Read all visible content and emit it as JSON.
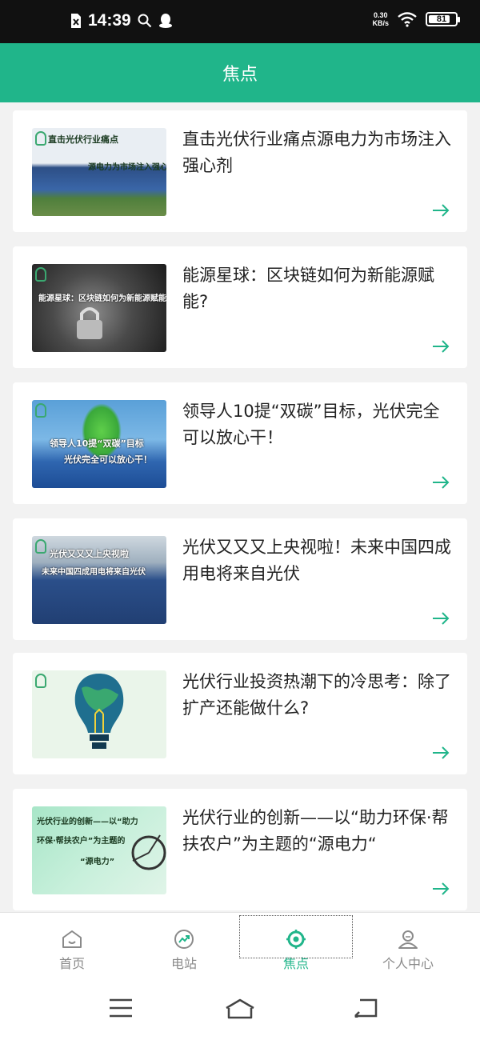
{
  "status_bar": {
    "time": "14:39",
    "net_speed_value": "0.30",
    "net_speed_unit": "KB/s",
    "battery": "81",
    "battery_level": 0.81
  },
  "header": {
    "title": "焦点"
  },
  "articles": [
    {
      "title": "直击光伏行业痛点源电力为市场注入强心剂",
      "thumb_caption_1": "直击光伏行业痛点",
      "thumb_caption_2": "源电力为市场注入强心剂"
    },
    {
      "title": "能源星球：区块链如何为新能源赋能?",
      "thumb_caption_1": "能源星球：区块链如何为新能源赋能?"
    },
    {
      "title": "领导人10提“双碳”目标，光伏完全可以放心干！",
      "thumb_caption_1": "领导人10提“双碳”目标",
      "thumb_caption_2": "光伏完全可以放心干！"
    },
    {
      "title": "光伏又又又上央视啦！未来中国四成用电将来自光伏",
      "thumb_caption_1": "光伏又又又上央视啦",
      "thumb_caption_2": "未来中国四成用电将来自光伏"
    },
    {
      "title": "光伏行业投资热潮下的冷思考：除了扩产还能做什么?"
    },
    {
      "title": "光伏行业的创新——以“助力环保·帮扶农户”为主题的“源电力“",
      "thumb_caption_1": "光伏行业的创新——以“助力",
      "thumb_caption_2": "环保·帮扶农户”为主题的",
      "thumb_caption_3": "“源电力”"
    }
  ],
  "bottom_nav": {
    "items": [
      {
        "label": "首页",
        "icon": "home-icon"
      },
      {
        "label": "电站",
        "icon": "station-icon"
      },
      {
        "label": "焦点",
        "icon": "focus-icon",
        "active": true
      },
      {
        "label": "个人中心",
        "icon": "user-icon"
      }
    ]
  },
  "colors": {
    "accent": "#20b58a",
    "status_bar": "#111111",
    "inactive_nav": "#8a8a8a"
  }
}
